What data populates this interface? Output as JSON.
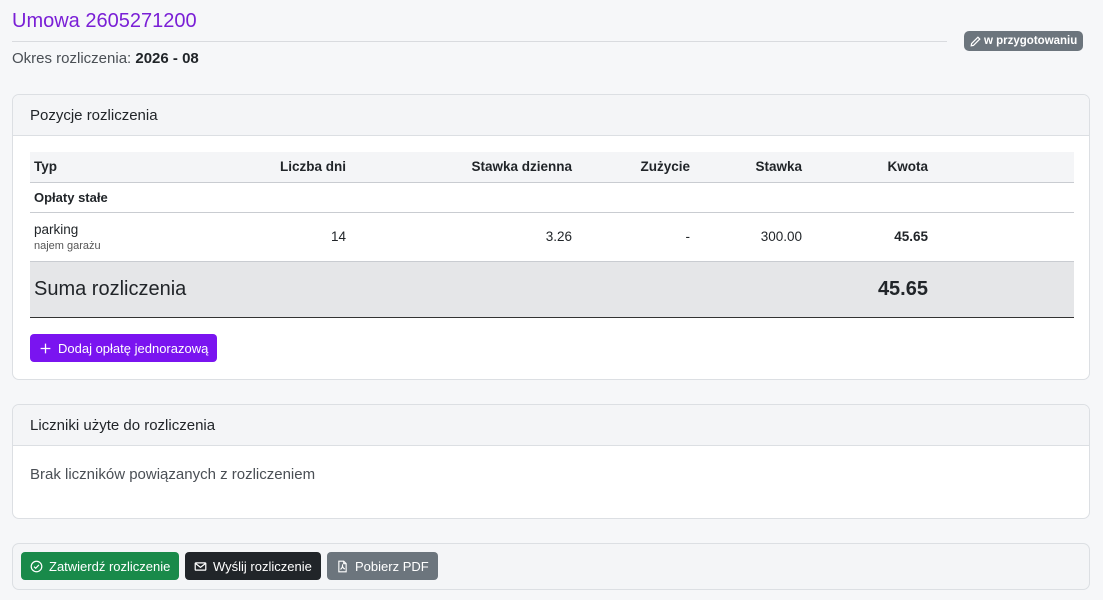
{
  "header": {
    "title": "Umowa 2605271200",
    "period_label": "Okres rozliczenia:",
    "period_value": "2026 - 08",
    "status_badge": "w przygotowaniu"
  },
  "positions_card": {
    "title": "Pozycje rozliczenia",
    "columns": [
      "Typ",
      "Liczba dni",
      "Stawka dzienna",
      "Zużycie",
      "Stawka",
      "Kwota"
    ],
    "group_label": "Opłaty stałe",
    "items": [
      {
        "name": "parking",
        "description": "najem garażu",
        "days": "14",
        "daily_rate": "3.26",
        "usage": "-",
        "rate": "300.00",
        "amount": "45.65"
      }
    ],
    "sum_label": "Suma rozliczenia",
    "sum_value": "45.65",
    "add_button": "Dodaj opłatę jednorazową"
  },
  "meters_card": {
    "title": "Liczniki użyte do rozliczenia",
    "empty_text": "Brak liczników powiązanych z rozliczeniem"
  },
  "actions": {
    "approve": "Zatwierdź rozliczenie",
    "send": "Wyślij rozliczenie",
    "pdf": "Pobierz PDF"
  },
  "colors": {
    "accent": "#7a14f0",
    "success": "#198a4a",
    "dark": "#212529",
    "secondary": "#6c757d"
  }
}
